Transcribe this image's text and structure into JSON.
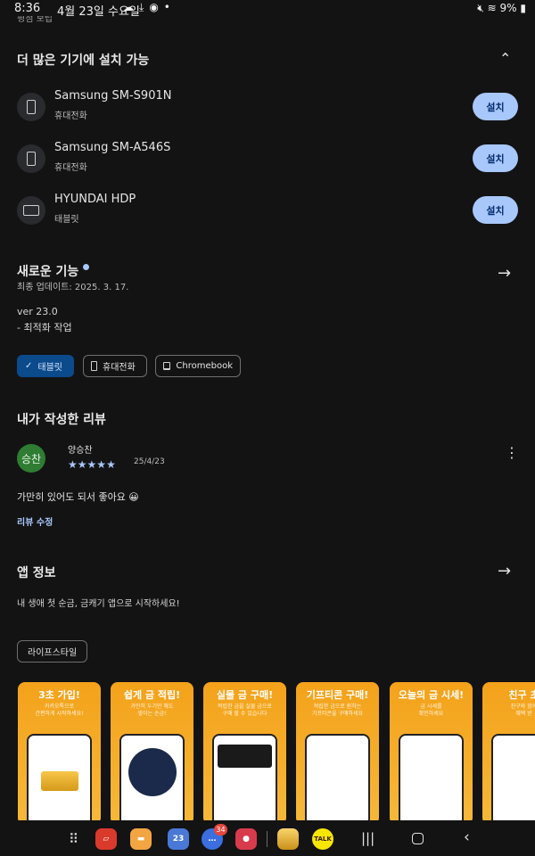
{
  "status_bar": {
    "time": "8:36",
    "date": "4월 23일 수요일",
    "battery": "9%",
    "icons": [
      "cloud-icon",
      "download-icon",
      "vpn-icon",
      "dot-icon"
    ]
  },
  "cut_text": "평점 보립",
  "more_devices": {
    "title": "더 많은 기기에 설치 가능",
    "devices": [
      {
        "name": "Samsung SM-S901N",
        "type": "휴대전화",
        "button": "설치"
      },
      {
        "name": "Samsung SM-A546S",
        "type": "휴대전화",
        "button": "설치"
      },
      {
        "name": "HYUNDAI HDP",
        "type": "태블릿",
        "button": "설치"
      }
    ]
  },
  "whats_new": {
    "title": "새로운 기능",
    "updated": "최종 업데이트: 2025. 3. 17.",
    "version": "ver 23.0",
    "note": "- 최적화 작업",
    "chips": [
      "태블릿",
      "휴대전화",
      "Chromebook"
    ]
  },
  "my_review": {
    "title": "내가 작성한 리뷰",
    "avatar_text": "승찬",
    "reviewer": "양승찬",
    "rating": 5,
    "date": "25/4/23",
    "text": "가만히 있어도 되서 좋아요 😀",
    "edit_link": "리뷰 수정"
  },
  "app_info": {
    "title": "앱 정보",
    "description": "내 생애 첫 순금, 금캐기 앱으로 시작하세요!",
    "tag": "라이프스타일"
  },
  "screenshots": [
    {
      "caption": "3초 가입!",
      "sub": "카카오톡으로\n간편하게 시작하세요!"
    },
    {
      "caption": "쉽게 금 적립!",
      "sub": "가만히 두기만 해도\n쌓이는 순금!"
    },
    {
      "caption": "실물 금 구매!",
      "sub": "적립한 금을 실물 금으로\n구매 할 수 있습니다"
    },
    {
      "caption": "기프티콘 구매!",
      "sub": "적립한 금으로 원하는\n기프티콘을 구매하세요"
    },
    {
      "caption": "오늘의 금 시세!",
      "sub": "금 시세를\n확인하세요"
    },
    {
      "caption": "친구 초",
      "sub": "친구와 함께\n혜택 받"
    }
  ],
  "nav_bar": {
    "badge_count": "34",
    "apps": [
      "app-drawer-icon",
      "notes-app-icon",
      "files-app-icon",
      "calendar-app-icon",
      "messages-app-icon",
      "screen-recorder-icon",
      "gold-app-icon",
      "kakaotalk-icon"
    ],
    "calendar_day": "23",
    "kakao_label": "TALK"
  },
  "colors": {
    "background": "#131314",
    "accent": "#a8c7fa",
    "selected_chip": "#0b4a8b",
    "avatar": "#2e7d32",
    "screenshot_orange": "#f4a21a"
  }
}
